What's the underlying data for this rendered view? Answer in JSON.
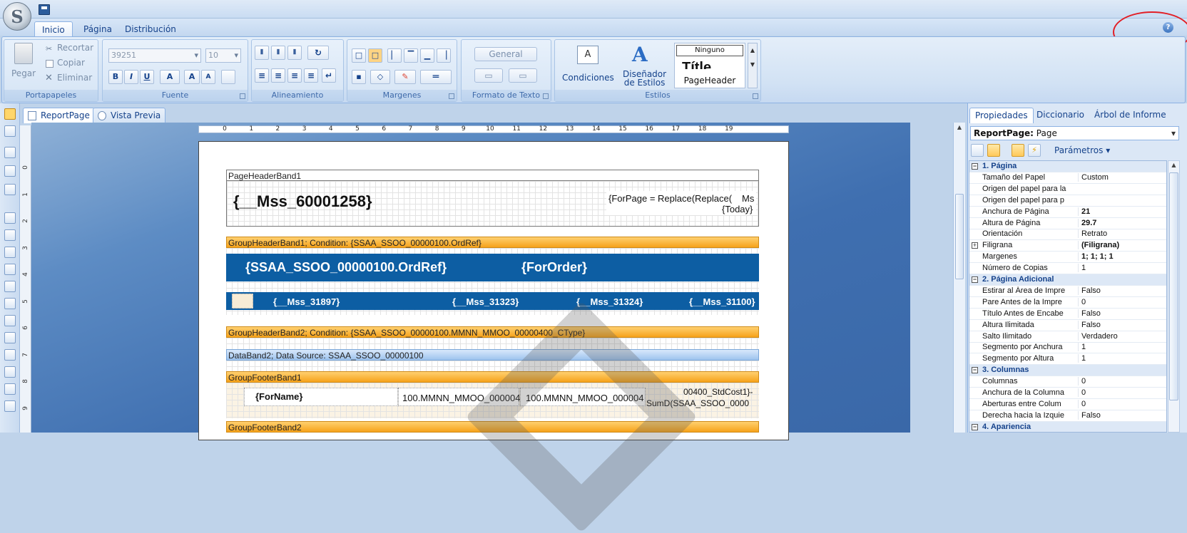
{
  "app": {
    "orb_glyph": "S"
  },
  "ribbon_tabs": [
    "Inicio",
    "Página",
    "Distribución"
  ],
  "help_label": "?",
  "groups": {
    "portapapeles": {
      "label": "Portapapeles",
      "paste": "Pegar",
      "cut": "Recortar",
      "copy": "Copiar",
      "delete": "Eliminar"
    },
    "fuente": {
      "label": "Fuente",
      "font_value": "39251",
      "size_value": "10",
      "bold": "B",
      "italic": "I",
      "underline": "U",
      "font_color": "A",
      "grow": "A",
      "shrink": "A"
    },
    "alineamiento": {
      "label": "Alineamiento"
    },
    "margenes": {
      "label": "Margenes"
    },
    "formato": {
      "label": "Formato de Texto",
      "general": "General"
    },
    "condiciones": {
      "label": "Condiciones"
    },
    "disenador": {
      "label_line1": "Diseñador",
      "label_line2": "de Estilos"
    },
    "estilos": {
      "label": "Estilos",
      "items": [
        "Ninguno",
        "Títle",
        "PageHeader"
      ]
    }
  },
  "doc_tabs": [
    "ReportPage",
    "Vista Previa"
  ],
  "ruler": {
    "h": [
      "0",
      "1",
      "2",
      "3",
      "4",
      "5",
      "6",
      "7",
      "8",
      "9",
      "10",
      "11",
      "12",
      "13",
      "14",
      "15",
      "16",
      "17",
      "18",
      "19"
    ],
    "v": [
      "0",
      "1",
      "2",
      "3",
      "4",
      "5",
      "6",
      "7",
      "8",
      "9"
    ]
  },
  "report": {
    "page_header_band": "PageHeaderBand1",
    "title_field": "{__Mss_60001258}",
    "for_page_line1": "{ForPage = Replace(Replace(",
    "for_page_ms": "Ms",
    "for_page_line2": "{Today}",
    "group_header1": "GroupHeaderBand1; Condition: {SSAA_SSOO_00000100.OrdRef}",
    "ordref_field": "{SSAA_SSOO_00000100.OrdRef}",
    "fororder_field": "{ForOrder}",
    "col_fields": [
      "{__Mss_31897}",
      "{__Mss_31323}",
      "{__Mss_31324}",
      "{__Mss_31100}"
    ],
    "group_header2": "GroupHeaderBand2; Condition: {SSAA_SSOO_00000100.MMNN_MMOO_00000400_CType}",
    "data_band": "DataBand2; Data Source: SSAA_SSOO_00000100",
    "group_footer1": "GroupFooterBand1",
    "forname_field": "{ForName}",
    "footer_cell1": "100.MMNN_MMOO_000004",
    "footer_cell2": "100.MMNN_MMOO_000004",
    "footer_cell3a": "00400_StdCost1}-",
    "footer_cell3b": "SumD(SSAA_SSOO_0000",
    "group_footer2": "GroupFooterBand2"
  },
  "panel": {
    "tabs": [
      "Propiedades",
      "Diccionario",
      "Árbol de Informe"
    ],
    "object_label": "ReportPage:",
    "object_type": "Page",
    "params_label": "Parámetros",
    "rows": [
      {
        "cat": true,
        "toggle": "−",
        "name": "1. Página"
      },
      {
        "name": "Tamaño del Papel",
        "value": "Custom"
      },
      {
        "name": "Origen del papel para la",
        "value": ""
      },
      {
        "name": "Origen del papel para p",
        "value": ""
      },
      {
        "name": "Anchura de Página",
        "value": "21",
        "bold": true
      },
      {
        "name": "Altura de Página",
        "value": "29.7",
        "bold": true
      },
      {
        "name": "Orientación",
        "value": "Retrato"
      },
      {
        "name": "Filigrana",
        "value": "(Filigrana)",
        "bold": true,
        "toggle": "+"
      },
      {
        "name": "Margenes",
        "value": "1; 1; 1; 1",
        "bold": true
      },
      {
        "name": "Número de Copias",
        "value": "1"
      },
      {
        "cat": true,
        "toggle": "−",
        "name": "2. Página Adicional"
      },
      {
        "name": "Estirar al Área de Impre",
        "value": "Falso"
      },
      {
        "name": "Pare Antes de la Impre",
        "value": "0"
      },
      {
        "name": "Título Antes de Encabe",
        "value": "Falso"
      },
      {
        "name": "Altura Ilimitada",
        "value": "Falso"
      },
      {
        "name": "Salto Ilimitado",
        "value": "Verdadero"
      },
      {
        "name": "Segmento por Anchura",
        "value": "1"
      },
      {
        "name": "Segmento por Altura",
        "value": "1"
      },
      {
        "cat": true,
        "toggle": "−",
        "name": "3. Columnas"
      },
      {
        "name": "Columnas",
        "value": "0"
      },
      {
        "name": "Anchura de la Columna",
        "value": "0"
      },
      {
        "name": "Aberturas entre Colum",
        "value": "0"
      },
      {
        "name": "Derecha hacia la Izquie",
        "value": "Falso"
      },
      {
        "cat": true,
        "toggle": "−",
        "name": "4. Apariencia"
      }
    ]
  },
  "colors": {
    "band_orange": "#f6a21a",
    "band_blue": "#0d5ea3",
    "annotation_red": "#e21f26"
  }
}
